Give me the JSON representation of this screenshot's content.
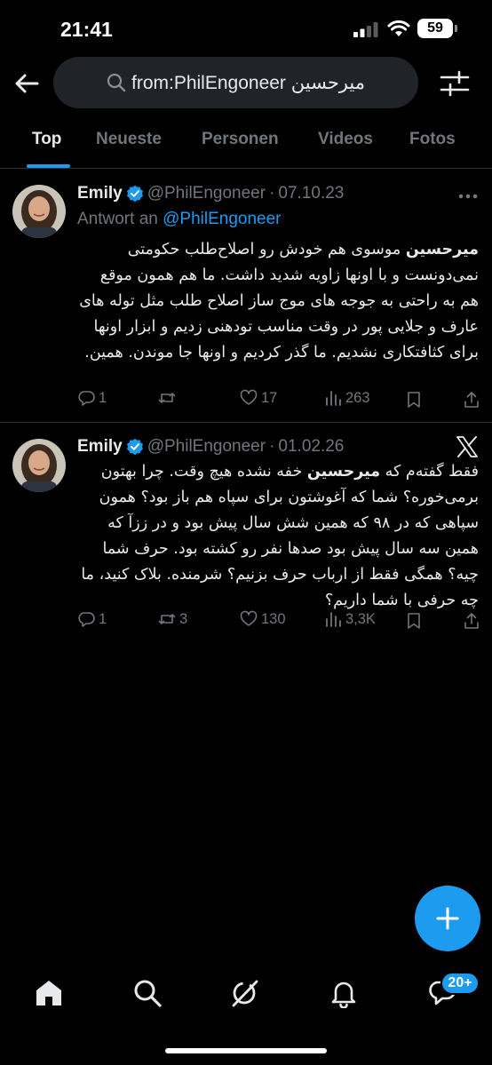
{
  "status_bar": {
    "time": "21:41",
    "battery": "59"
  },
  "search": {
    "query": "from:PhilEngoneer میرحسین"
  },
  "tabs": [
    {
      "label": "Top",
      "active": true
    },
    {
      "label": "Neueste"
    },
    {
      "label": "Personen"
    },
    {
      "label": "Videos"
    },
    {
      "label": "Fotos"
    }
  ],
  "tweets": [
    {
      "author": "Emily",
      "handle": "@PhilEngoneer",
      "date": "07.10.23",
      "reply_prefix": "Antwort an",
      "reply_handle": "@PhilEngoneer",
      "text_bold": "میرحسین",
      "text_rest": " موسوی هم خودش رو اصلاح‌طلب حکومتی نمی‌دونست و با اونها زاویه شدید داشت. ما هم همون موقع هم به راحتی به جوجه های موج ساز اصلاح طلب مثل توله های عارف و جلایی پور در وقت مناسب تودهنی زدیم و ابزار اونها برای کثافتکاری نشدیم. ما گذر کردیم و اونها جا موندن. همین.",
      "replies": "1",
      "retweets": "",
      "likes": "17",
      "views": "263"
    },
    {
      "author": "Emily",
      "handle": "@PhilEngoneer",
      "date": "01.02.26",
      "text_pre": "فقط گفته‌م که ",
      "text_bold": "میرحسین",
      "text_rest": " خفه نشده هیچ وقت. چرا بهتون برمی‌خوره؟ شما که آغوشتون برای سپاه هم باز بود؟ همون سپاهی که در ۹۸ که همین شش سال پیش بود و در ز‌زآ که همین سه سال پیش بود صدها نفر رو کشته بود. حرف شما چیه؟ همگی فقط از ارباب حرف بزنیم؟ شرمنده. بلاک کنید، ما چه حرفی با شما داریم؟",
      "replies": "1",
      "retweets": "3",
      "likes": "130",
      "views": "3,3K"
    }
  ],
  "bottom_nav": {
    "messages_badge": "20+"
  },
  "colors": {
    "accent": "#1d9bf0",
    "background": "#000000",
    "muted": "#71767b"
  }
}
